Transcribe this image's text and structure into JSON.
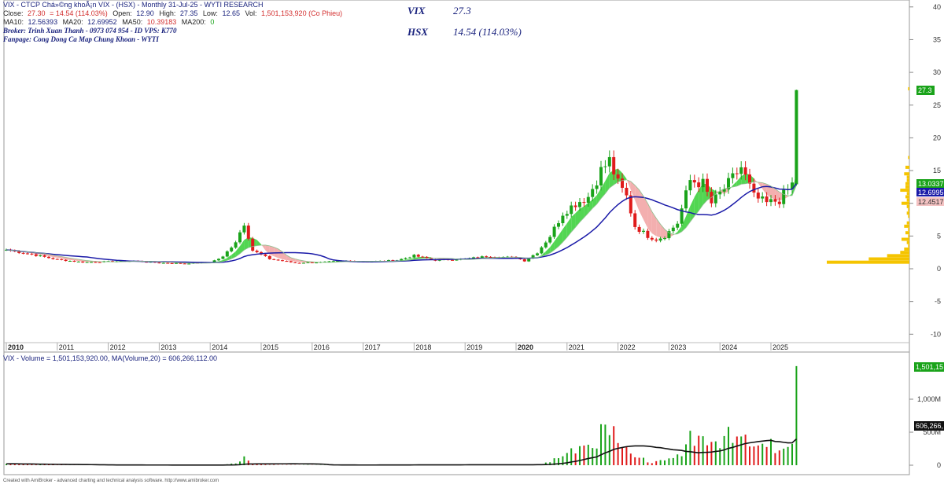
{
  "header": {
    "line1_prefix": "VIX - CTCP Chá»©ng khoÃ¡n VIX - (HSX) - Monthly 31-Jul-25 - WYTI RESEARCH",
    "close_label": "Close:",
    "close_value": "27.30",
    "change_value": "= 14.54 (114.03%)",
    "open_label": "Open:",
    "open_value": "12.90",
    "high_label": "High:",
    "high_value": "27.35",
    "low_label": "Low:",
    "low_value": "12.65",
    "vol_label": "Vol:",
    "vol_value": "1,501,153,920 (Co Phieu)",
    "ma10_label": "MA10:",
    "ma10_value": "12.56393",
    "ma20_label": "MA20:",
    "ma20_value": "12.69952",
    "ma50_label": "MA50:",
    "ma50_value": "10.39183",
    "ma200_label": "MA200:",
    "ma200_value": "0",
    "broker": "Broker: Trinh Xuan Thanh - 0973 074 954 - ID VPS: K770",
    "fanpage": "Fanpage: Cong Dong Ca Map Chung Khoan - WYTI"
  },
  "overlay": {
    "ticker": "VIX",
    "ticker_price": "27.3",
    "exchange": "HSX",
    "exchange_change": "14.54 (114.03%)"
  },
  "volume_header": "VIX - Volume = 1,501,153,920.00, MA(Volume,20) = 606,266,112.00",
  "footer": "Created with AmiBroker - advanced charting and technical analysis software. http://www.amibroker.com",
  "price_axis_ticks": [
    "40",
    "35",
    "30",
    "25",
    "20",
    "15",
    "10",
    "5",
    "0",
    "-5",
    "-10"
  ],
  "volume_axis_ticks": [
    "1,000M",
    "500M",
    "0"
  ],
  "axis_tags": {
    "last_price": "27.3",
    "ma_top": "13.0337",
    "ma_mid": "12.6995",
    "ma_low": "12.4517",
    "last_volume": "1,501,15",
    "vol_ma": "606,266,"
  },
  "year_labels": [
    "2010",
    "2011",
    "2012",
    "2013",
    "2014",
    "2015",
    "2016",
    "2017",
    "2018",
    "2019",
    "2020",
    "2021",
    "2022",
    "2023",
    "2024",
    "2025"
  ],
  "colors": {
    "up": "#1aa31a",
    "down": "#e01b1b",
    "ma_blue": "#1a1aa8",
    "cloud_green": "#3fd13f",
    "cloud_pink": "#f2a6a6",
    "profile": "#f5c400",
    "axis_text": "#333333",
    "title_blue": "#1a237e"
  },
  "chart_data": {
    "type": "candlestick",
    "title": "VIX - CTCP Chá»©ng khoÃ¡n VIX - (HSX) - Monthly 31-Jul-25 - WYTI RESEARCH",
    "price_ylim": [
      -12,
      42
    ],
    "volume_ylim": [
      0,
      1500000000
    ],
    "grid": false,
    "x_ticks": [
      "2010",
      "2011",
      "2012",
      "2013",
      "2014",
      "2015",
      "2016",
      "2017",
      "2018",
      "2019",
      "2020",
      "2021",
      "2022",
      "2023",
      "2024",
      "2025"
    ],
    "price_anchors": [
      {
        "date": "2010-01",
        "price": 2.9
      },
      {
        "date": "2010-07",
        "price": 2.2
      },
      {
        "date": "2011-01",
        "price": 1.4
      },
      {
        "date": "2011-07",
        "price": 1.0
      },
      {
        "date": "2012-01",
        "price": 1.1
      },
      {
        "date": "2012-07",
        "price": 1.2
      },
      {
        "date": "2013-01",
        "price": 0.9
      },
      {
        "date": "2013-07",
        "price": 0.8
      },
      {
        "date": "2014-01",
        "price": 1.0
      },
      {
        "date": "2014-04",
        "price": 1.8
      },
      {
        "date": "2014-07",
        "price": 4.2
      },
      {
        "date": "2014-09",
        "price": 7.0
      },
      {
        "date": "2014-11",
        "price": 2.8
      },
      {
        "date": "2015-03",
        "price": 1.5
      },
      {
        "date": "2015-09",
        "price": 0.9
      },
      {
        "date": "2016-03",
        "price": 1.0
      },
      {
        "date": "2016-09",
        "price": 1.2
      },
      {
        "date": "2017-03",
        "price": 1.1
      },
      {
        "date": "2017-09",
        "price": 1.3
      },
      {
        "date": "2018-01",
        "price": 2.0
      },
      {
        "date": "2018-06",
        "price": 1.3
      },
      {
        "date": "2019-01",
        "price": 1.5
      },
      {
        "date": "2019-06",
        "price": 1.9
      },
      {
        "date": "2020-01",
        "price": 1.7
      },
      {
        "date": "2020-03",
        "price": 1.2
      },
      {
        "date": "2020-06",
        "price": 2.5
      },
      {
        "date": "2020-09",
        "price": 5.0
      },
      {
        "date": "2020-12",
        "price": 8.5
      },
      {
        "date": "2021-03",
        "price": 10.0
      },
      {
        "date": "2021-06",
        "price": 11.0
      },
      {
        "date": "2021-09",
        "price": 15.0
      },
      {
        "date": "2021-11",
        "price": 16.5
      },
      {
        "date": "2022-01",
        "price": 13.0
      },
      {
        "date": "2022-03",
        "price": 11.0
      },
      {
        "date": "2022-05",
        "price": 6.5
      },
      {
        "date": "2022-08",
        "price": 5.0
      },
      {
        "date": "2022-10",
        "price": 4.5
      },
      {
        "date": "2022-12",
        "price": 5.0
      },
      {
        "date": "2023-03",
        "price": 7.0
      },
      {
        "date": "2023-06",
        "price": 13.5
      },
      {
        "date": "2023-09",
        "price": 13.0
      },
      {
        "date": "2023-11",
        "price": 10.0
      },
      {
        "date": "2024-03",
        "price": 13.0
      },
      {
        "date": "2024-06",
        "price": 15.5
      },
      {
        "date": "2024-09",
        "price": 11.0
      },
      {
        "date": "2024-12",
        "price": 10.0
      },
      {
        "date": "2025-03",
        "price": 10.5
      },
      {
        "date": "2025-06",
        "price": 12.9
      },
      {
        "date": "2025-07",
        "price": 27.3
      }
    ],
    "last_candle": {
      "date": "2025-07",
      "open": 12.9,
      "high": 27.35,
      "low": 12.65,
      "close": 27.3,
      "volume": 1501153920
    },
    "series": [
      {
        "name": "MA10",
        "last": 12.56393
      },
      {
        "name": "MA20",
        "last": 12.69952
      },
      {
        "name": "MA50",
        "last": 10.39183
      },
      {
        "name": "MA200",
        "last": 0
      },
      {
        "name": "MA(Volume,20)",
        "last": 606266112
      }
    ]
  }
}
